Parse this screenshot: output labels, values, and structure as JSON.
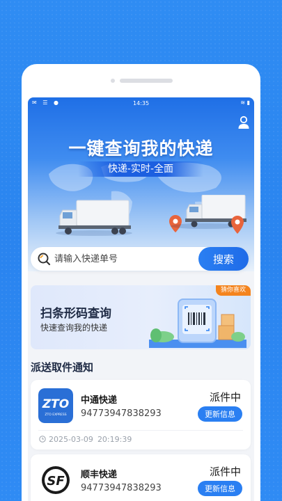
{
  "status_bar": {
    "time": "14:35"
  },
  "banner": {
    "headline": "一键查询我的快递",
    "subtitle": "快递-实时-全面"
  },
  "search": {
    "placeholder": "请输入快递单号",
    "button_label": "搜索"
  },
  "promo": {
    "title": "扫条形码查询",
    "subtitle": "快速查询我的快递",
    "tag": "猜你喜欢"
  },
  "section": {
    "title": "派送取件通知"
  },
  "parcels": [
    {
      "carrier": "中通快递",
      "logo_text": "ZTO",
      "logo_subtext": "ZTO EXPRESS",
      "tracking_number": "94773947838293",
      "status": "派件中",
      "update_label": "更新信息",
      "date": "2025-03-09",
      "time": "20:19:39"
    },
    {
      "carrier": "顺丰快递",
      "logo_text": "SF",
      "tracking_number": "94773947838293",
      "status": "派件中",
      "update_label": "更新信息"
    }
  ],
  "colors": {
    "primary": "#2a7ff2",
    "background": "#2f8cf3",
    "tag": "#f4841e",
    "zto_logo": "#2a6fd6",
    "pin": "#e8643c"
  },
  "icons": [
    "user-icon",
    "search-icon",
    "clock-icon",
    "barcode-icon",
    "location-pin-icon",
    "truck-icon"
  ]
}
